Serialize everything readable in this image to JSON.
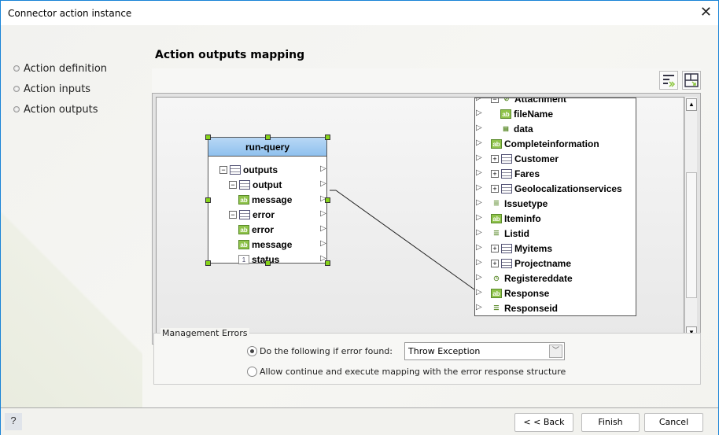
{
  "window": {
    "title": "Connector action instance",
    "close_icon": "close-icon"
  },
  "steps": [
    {
      "label": "Action definition"
    },
    {
      "label": "Action inputs"
    },
    {
      "label": "Action outputs"
    }
  ],
  "heading": "Action outputs mapping",
  "toolbar": {
    "auto_map_icon": "auto-map-icon",
    "layout_icon": "layout-icon"
  },
  "source_node": {
    "title": "run-query",
    "rows": [
      {
        "label": "outputs",
        "type": "table",
        "expander": "−",
        "level": 0
      },
      {
        "label": "output",
        "type": "table",
        "expander": "−",
        "level": 1
      },
      {
        "label": "message",
        "type": "text",
        "level": 2
      },
      {
        "label": "error",
        "type": "table",
        "expander": "−",
        "level": 1
      },
      {
        "label": "error",
        "type": "text",
        "level": 2
      },
      {
        "label": "message",
        "type": "text",
        "level": 2
      },
      {
        "label": "status",
        "type": "number",
        "level": 2
      }
    ]
  },
  "target_tree": {
    "rows": [
      {
        "label": "Attachment",
        "type": "attach",
        "expander": "−",
        "level": 1
      },
      {
        "label": "fileName",
        "type": "text",
        "level": 2
      },
      {
        "label": "data",
        "type": "file",
        "level": 2
      },
      {
        "label": "Completeinformation",
        "type": "text",
        "level": 1
      },
      {
        "label": "Customer",
        "type": "table",
        "expander": "+",
        "level": 1
      },
      {
        "label": "Fares",
        "type": "list",
        "expander": "+",
        "level": 1
      },
      {
        "label": "Geolocalizationservices",
        "type": "table",
        "expander": "+",
        "level": 1
      },
      {
        "label": "Issuetype",
        "type": "choice",
        "level": 1
      },
      {
        "label": "Iteminfo",
        "type": "text",
        "level": 1
      },
      {
        "label": "Listid",
        "type": "choice",
        "level": 1
      },
      {
        "label": "Myitems",
        "type": "list",
        "expander": "+",
        "level": 1
      },
      {
        "label": "Projectname",
        "type": "grid",
        "expander": "+",
        "level": 1
      },
      {
        "label": "Registereddate",
        "type": "date",
        "level": 1
      },
      {
        "label": "Response",
        "type": "text",
        "level": 1
      },
      {
        "label": "Responseid",
        "type": "choice",
        "level": 1
      }
    ]
  },
  "mapping": {
    "from": "message",
    "to": "Response"
  },
  "errors": {
    "legend": "Management Errors",
    "option1": "Do the following if error found:",
    "option1_selected": true,
    "option2": "Allow continue and execute mapping with the error response structure",
    "select_value": "Throw Exception"
  },
  "footer": {
    "back": "< < Back",
    "finish": "Finish",
    "cancel": "Cancel",
    "help_icon": "help-icon"
  }
}
